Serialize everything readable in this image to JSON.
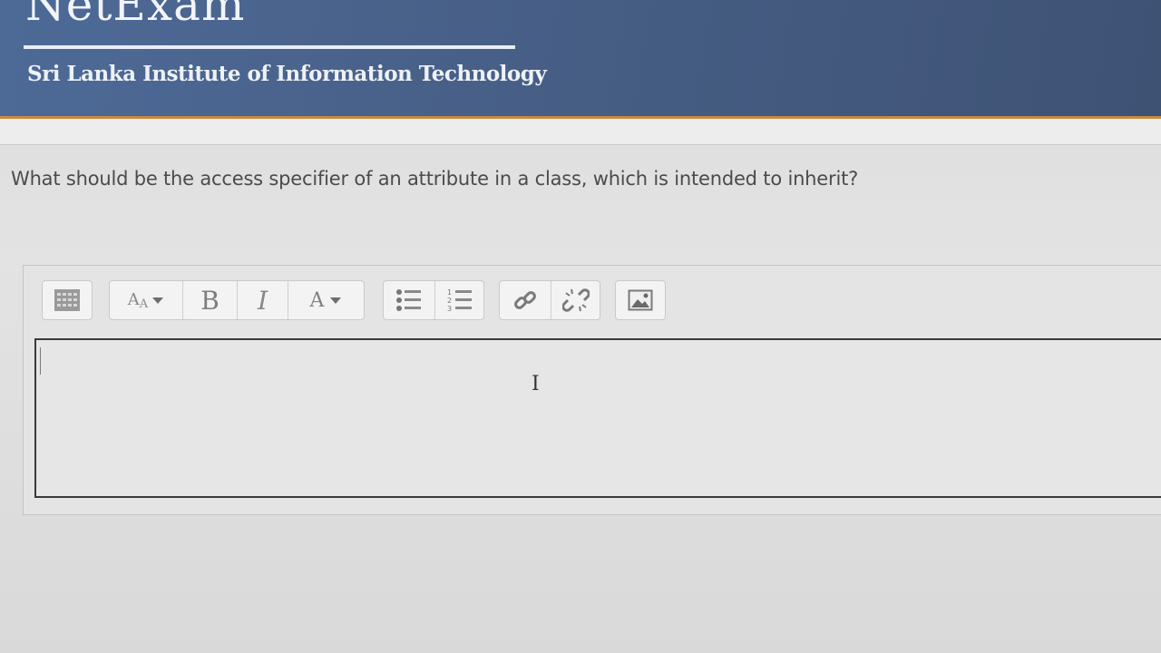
{
  "header": {
    "logo": "NetExam",
    "institution": "Sri Lanka Institute of Information Technology"
  },
  "question": {
    "text": "What should be the access specifier of an attribute in a class, which is intended to  inherit?"
  },
  "toolbar": {
    "buttons": [
      {
        "name": "toolbar-toggle",
        "icon": "toolbar-toggle-icon"
      },
      {
        "name": "paragraph-styles",
        "label": "A",
        "icon": "font-styles-icon"
      },
      {
        "name": "bold",
        "label": "B"
      },
      {
        "name": "italic",
        "label": "I"
      },
      {
        "name": "font-color",
        "label": "A"
      },
      {
        "name": "unordered-list",
        "icon": "bullet-list-icon"
      },
      {
        "name": "ordered-list",
        "icon": "numbered-list-icon"
      },
      {
        "name": "link",
        "icon": "link-icon"
      },
      {
        "name": "unlink",
        "icon": "unlink-icon"
      },
      {
        "name": "insert-image",
        "icon": "image-icon"
      }
    ]
  },
  "editor": {
    "value": ""
  },
  "colors": {
    "header_bg": "#4a6590",
    "header_accent": "#c98a3d",
    "text": "#4b4b4b"
  }
}
